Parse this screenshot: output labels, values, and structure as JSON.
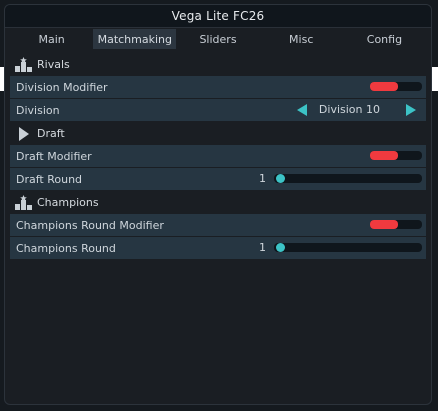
{
  "window": {
    "title": "Vega Lite FC26"
  },
  "tabs": [
    {
      "label": "Main"
    },
    {
      "label": "Matchmaking"
    },
    {
      "label": "Sliders"
    },
    {
      "label": "Misc"
    },
    {
      "label": "Config"
    }
  ],
  "active_tab": "Matchmaking",
  "sections": {
    "rivals": {
      "title": "Rivals",
      "icon": "podium-icon",
      "division_modifier": {
        "label": "Division Modifier",
        "enabled": true
      },
      "division": {
        "label": "Division",
        "value": "Division 10"
      }
    },
    "draft": {
      "title": "Draft",
      "icon": "play-icon",
      "draft_modifier": {
        "label": "Draft Modifier",
        "enabled": true
      },
      "draft_round": {
        "label": "Draft Round",
        "value": "1"
      }
    },
    "champions": {
      "title": "Champions",
      "icon": "podium-icon",
      "champions_round_modifier": {
        "label": "Champions Round Modifier",
        "enabled": true
      },
      "champions_round": {
        "label": "Champions Round",
        "value": "1"
      }
    }
  },
  "colors": {
    "accent": "#3cc3c6",
    "toggle_on": "#f03a3f",
    "row_bg": "#263642"
  }
}
